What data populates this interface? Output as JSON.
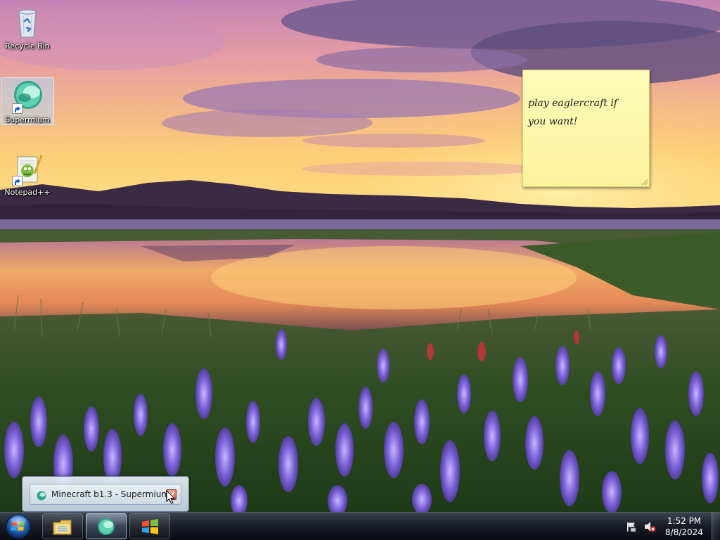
{
  "desktop": {
    "icons": [
      {
        "label": "Recycle Bin",
        "icon": "recycle-bin-icon"
      },
      {
        "label": "Supermium",
        "icon": "supermium-icon",
        "selected": true
      },
      {
        "label": "Notepad++",
        "icon": "notepad-plus-plus-icon"
      }
    ],
    "sticky_note": {
      "text": "play eaglercraft if\nyou want!",
      "color": "#fcf5a6"
    }
  },
  "taskbar_popup": {
    "title": "Minecraft b1.3 - Supermium",
    "icon": "supermium-icon"
  },
  "taskbar": {
    "start_icon": "windows-start-orb-icon",
    "buttons": [
      {
        "icon": "windows-explorer-icon",
        "state": "pinned"
      },
      {
        "icon": "supermium-icon",
        "state": "active"
      },
      {
        "icon": "windows-logo-icon",
        "state": "pinned"
      }
    ],
    "tray": {
      "icons": [
        "action-center-flag-icon",
        "volume-muted-icon"
      ],
      "time": "1:52 PM",
      "date": "8/8/2024"
    }
  },
  "colors": {
    "accent_selection": "#b4d7f5",
    "taskbar": "#14181f"
  }
}
